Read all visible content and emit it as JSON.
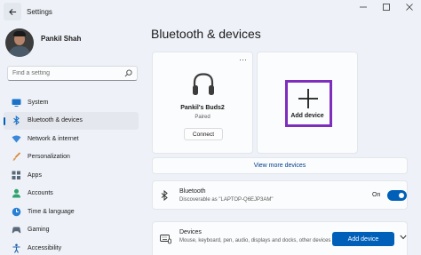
{
  "window": {
    "title": "Settings"
  },
  "user": {
    "name": "Pankil Shah"
  },
  "search": {
    "placeholder": "Find a setting"
  },
  "sidebar": {
    "items": [
      {
        "label": "System",
        "icon": "monitor-icon",
        "active": false
      },
      {
        "label": "Bluetooth & devices",
        "icon": "bluetooth-icon",
        "active": true
      },
      {
        "label": "Network & internet",
        "icon": "wifi-icon",
        "active": false
      },
      {
        "label": "Personalization",
        "icon": "brush-icon",
        "active": false
      },
      {
        "label": "Apps",
        "icon": "apps-icon",
        "active": false
      },
      {
        "label": "Accounts",
        "icon": "person-icon",
        "active": false
      },
      {
        "label": "Time & language",
        "icon": "globe-clock-icon",
        "active": false
      },
      {
        "label": "Gaming",
        "icon": "gamepad-icon",
        "active": false
      },
      {
        "label": "Accessibility",
        "icon": "accessibility-icon",
        "active": false
      }
    ]
  },
  "main": {
    "title": "Bluetooth & devices",
    "device_card": {
      "name": "Pankil's Buds2",
      "status": "Paired",
      "connect_label": "Connect",
      "more": "···"
    },
    "add_card": {
      "label": "Add device"
    },
    "view_more": "View more devices",
    "bluetooth": {
      "title": "Bluetooth",
      "subtitle": "Discoverable as \"LAPTOP-Q6EJP3AM\"",
      "state": "On",
      "enabled": true
    },
    "devices": {
      "title": "Devices",
      "subtitle": "Mouse, keyboard, pen, audio, displays and docks, other devices",
      "add_label": "Add device"
    }
  },
  "colors": {
    "accent": "#005fb8",
    "highlight": "#7e2dbd",
    "background": "#eef2f8"
  }
}
